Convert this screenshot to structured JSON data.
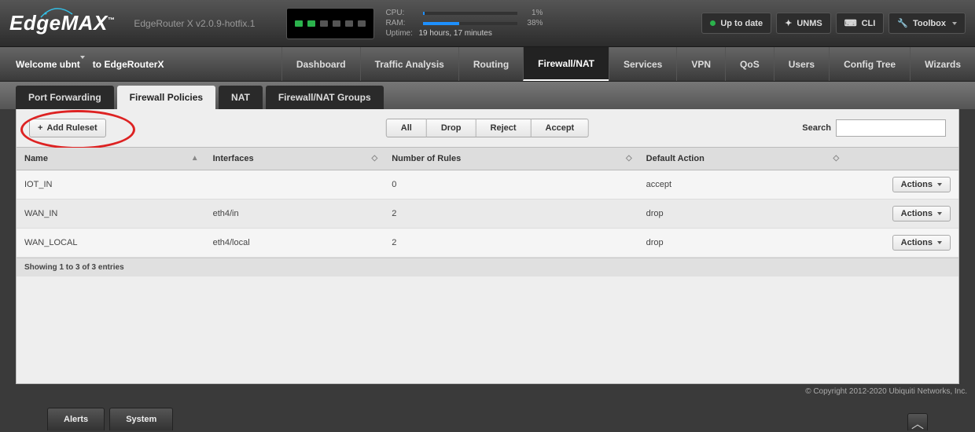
{
  "header": {
    "logo": "EdgeMAX",
    "model": "EdgeRouter X v2.0.9-hotfix.1",
    "cpu_label": "CPU:",
    "cpu_pct": "1%",
    "ram_label": "RAM:",
    "ram_pct": "38%",
    "uptime_label": "Uptime:",
    "uptime_value": "19 hours, 17 minutes",
    "uptodate": "Up to date",
    "unms": "UNMS",
    "cli": "CLI",
    "toolbox": "Toolbox"
  },
  "welcome": {
    "greeting": "Welcome ubnt",
    "to_device": "to EdgeRouterX"
  },
  "mainnav": [
    "Dashboard",
    "Traffic Analysis",
    "Routing",
    "Firewall/NAT",
    "Services",
    "VPN",
    "QoS",
    "Users",
    "Config Tree",
    "Wizards"
  ],
  "mainnav_active": 3,
  "subtabs": [
    "Port Forwarding",
    "Firewall Policies",
    "NAT",
    "Firewall/NAT Groups"
  ],
  "subtabs_active": 1,
  "toolbar": {
    "add_label": "Add Ruleset",
    "filters": [
      "All",
      "Drop",
      "Reject",
      "Accept"
    ],
    "search_label": "Search"
  },
  "columns": [
    "Name",
    "Interfaces",
    "Number of Rules",
    "Default Action",
    ""
  ],
  "rows": [
    {
      "name": "IOT_IN",
      "interfaces": "",
      "rules": "0",
      "action": "accept"
    },
    {
      "name": "WAN_IN",
      "interfaces": "eth4/in",
      "rules": "2",
      "action": "drop"
    },
    {
      "name": "WAN_LOCAL",
      "interfaces": "eth4/local",
      "rules": "2",
      "action": "drop"
    }
  ],
  "actions_label": "Actions",
  "showing": "Showing 1 to 3 of 3 entries",
  "copyright": "© Copyright 2012-2020 Ubiquiti Networks, Inc.",
  "bottom": {
    "alerts": "Alerts",
    "system": "System"
  }
}
